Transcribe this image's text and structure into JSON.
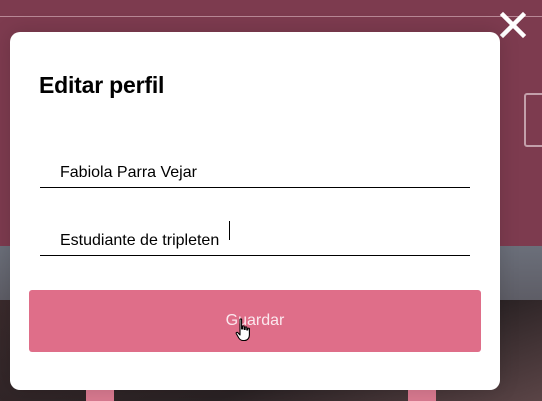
{
  "background": {
    "colors": {
      "overlay": "#7d3b4f"
    }
  },
  "modal": {
    "title": "Editar perfil",
    "close_icon": "close-icon",
    "fields": {
      "name": {
        "value": "Fabiola Parra Vejar"
      },
      "about": {
        "value": "Estudiante de tripleten"
      }
    },
    "save_label": "Guardar",
    "colors": {
      "save_button": "#df6e89",
      "modal_bg": "#ffffff"
    }
  },
  "cursor": "hand-pointer-icon"
}
